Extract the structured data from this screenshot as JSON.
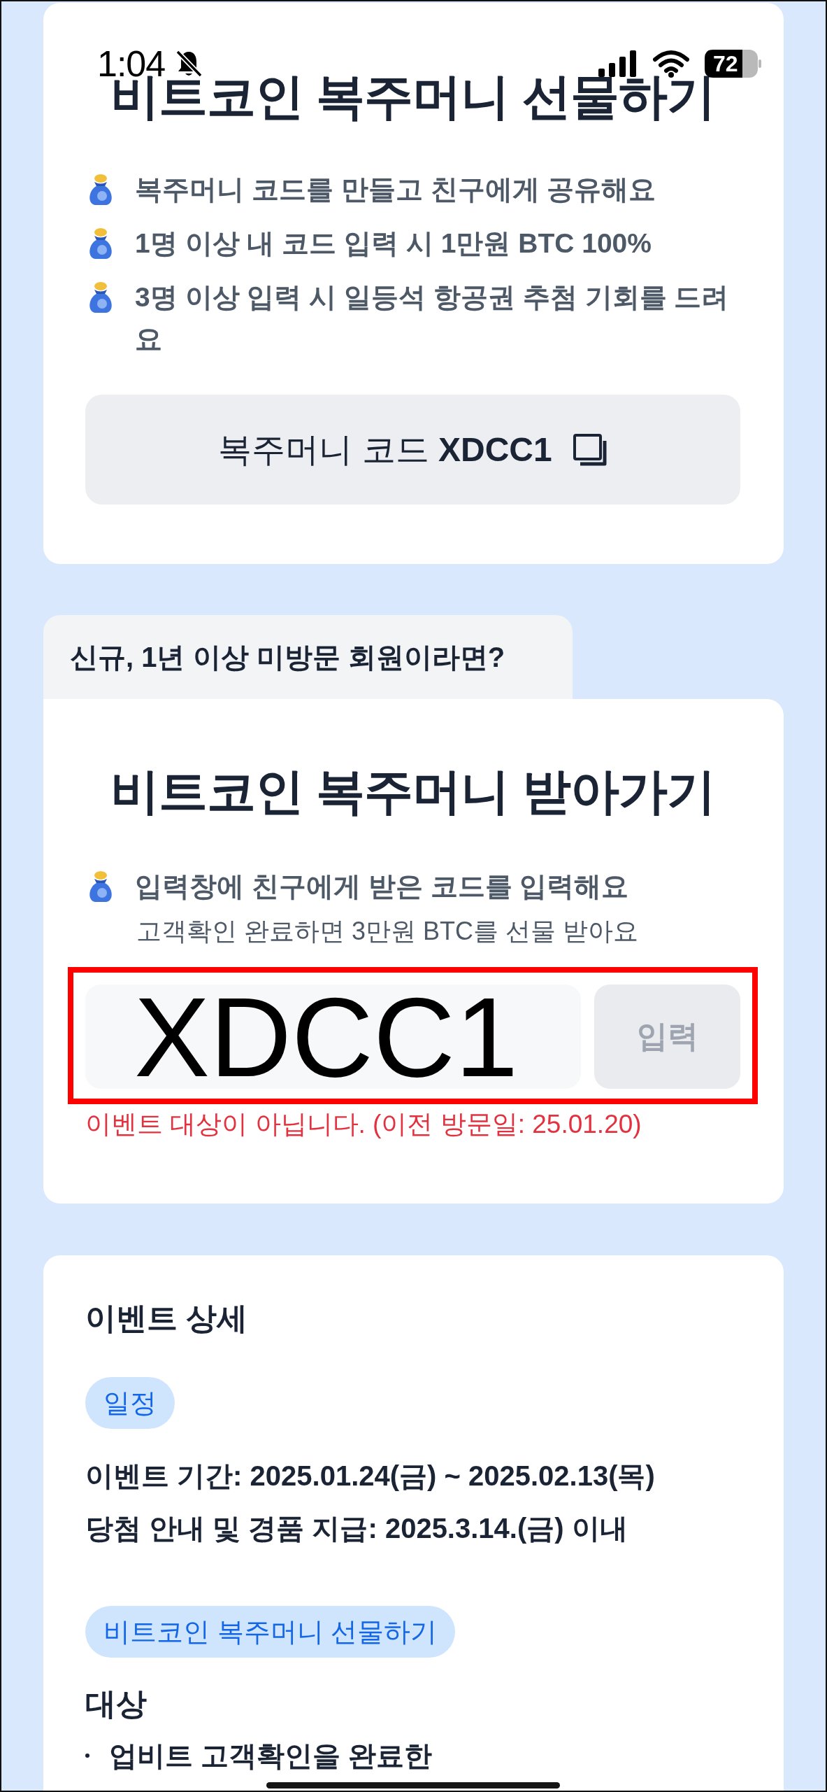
{
  "status_bar": {
    "time": "1:04",
    "battery": "72"
  },
  "gift_card": {
    "title": "비트코인 복주머니 선물하기",
    "bullets": [
      "복주머니 코드를 만들고 친구에게 공유해요",
      "1명 이상 내 코드 입력 시 1만원 BTC 100%",
      "3명 이상 입력 시 일등석 항공권 추첨 기회를 드려요"
    ],
    "code_button": "복주머니 코드 **XDCC1**"
  },
  "receive_tab": "신규, 1년 이상 미방문 회원이라면?",
  "receive_card": {
    "title": "비트코인 복주머니 받아가기",
    "bullet": "입력창에 친구에게 받은 코드를 입력해요",
    "note": "고객확인 완료하면 3만원 BTC를 선물 받아요",
    "code_input": {
      "value": "XDCC1"
    },
    "submit_button": {
      "label": "입력",
      "disabled": true
    },
    "highlighted": true,
    "error": "이벤트 대상이 아닙니다. (이전 방문일: 25.01.20)"
  },
  "details_card": {
    "title": "이벤트 상세",
    "schedule_tag": "일정",
    "schedule_lines": [
      "이벤트 기간: 2025.01.24(금) ~ 2025.02.13(목)",
      "당첨 안내 및 경품 지급: 2025.3.14.(금) 이내"
    ],
    "gift_tag": "비트코인 복주머니 선물하기",
    "eligibility_heading": "대상",
    "eligibility_items": [
      "업비트 고객확인을 완료한"
    ]
  }
}
